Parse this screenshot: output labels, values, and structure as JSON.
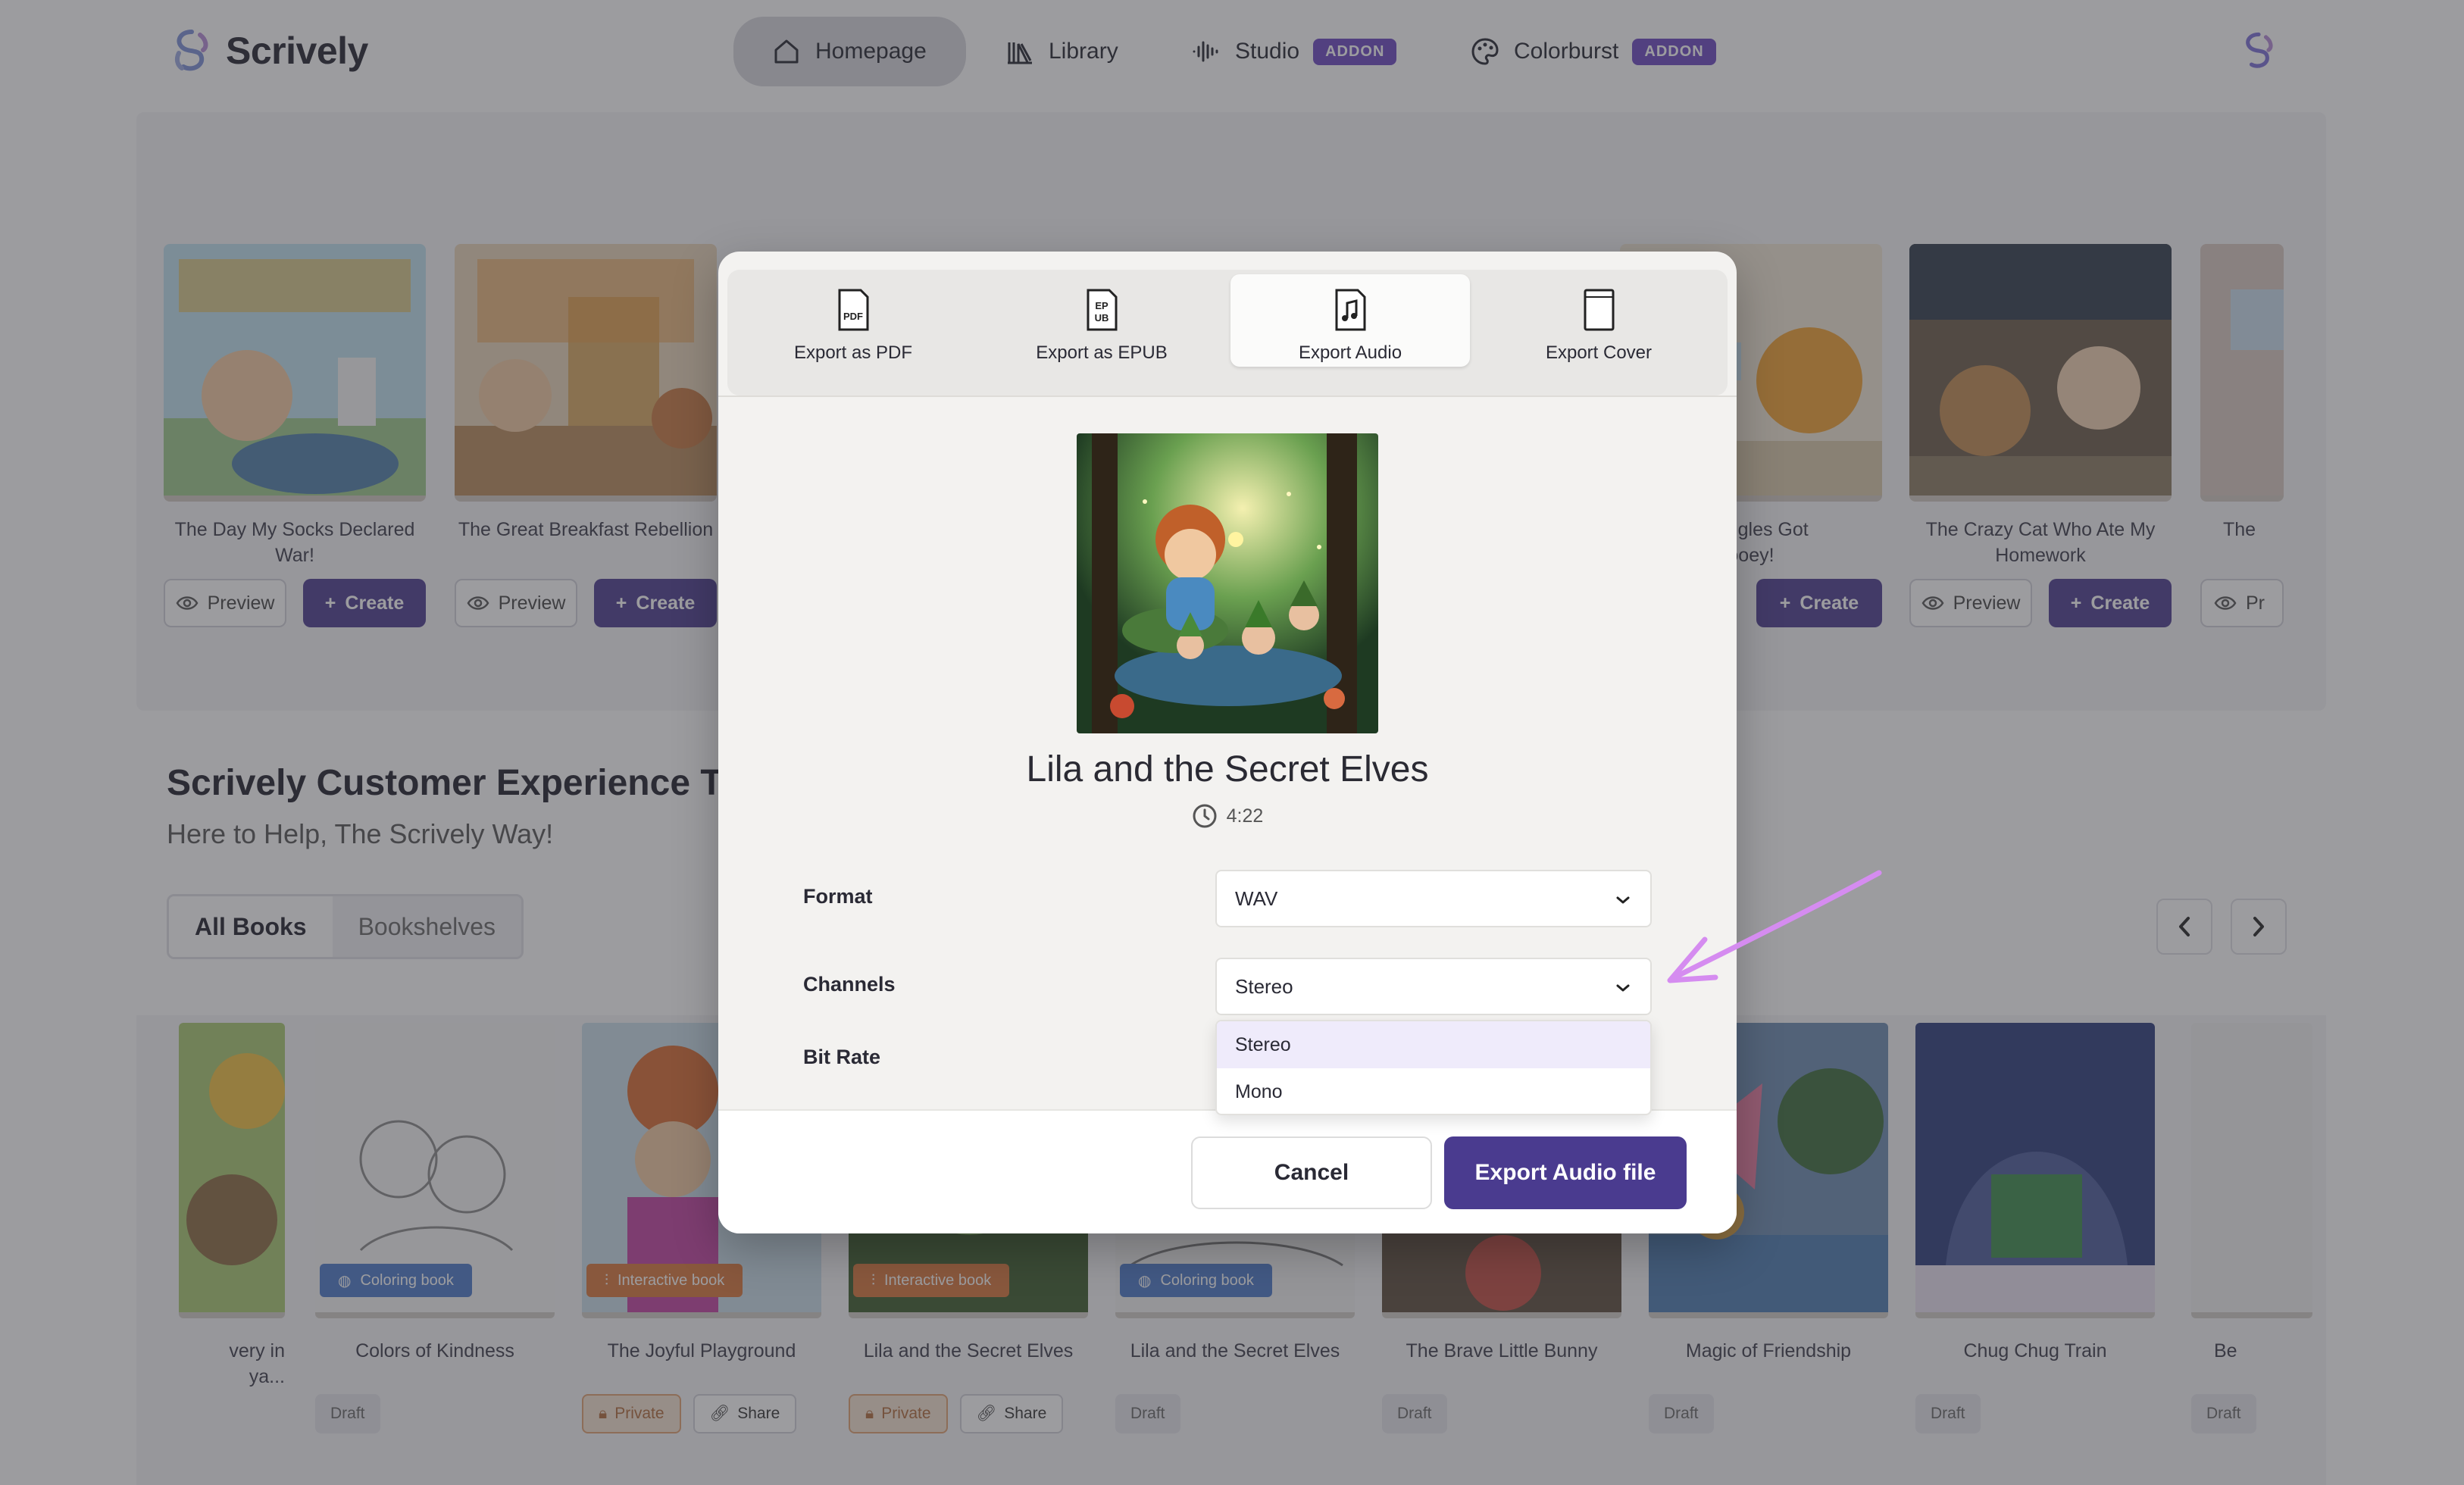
{
  "nav": {
    "brand": "Scrively",
    "items": [
      {
        "label": "Homepage",
        "icon": "home-icon",
        "active": true
      },
      {
        "label": "Library",
        "icon": "library-icon"
      },
      {
        "label": "Studio",
        "icon": "waveform-icon",
        "badge": "ADDON"
      },
      {
        "label": "Colorburst",
        "icon": "palette-icon",
        "badge": "ADDON"
      }
    ]
  },
  "featured": {
    "books": [
      {
        "title": "The Day My Socks Declared War!"
      },
      {
        "title": "The Great Breakfast Rebellion"
      },
      {
        "title": "y Giggles Got\nooey!"
      },
      {
        "title": "The Crazy Cat Who Ate My Homework"
      },
      {
        "title": "The"
      }
    ],
    "preview_label": "Preview",
    "create_label": "Create",
    "preview_partial": "Pr"
  },
  "section": {
    "title": "Scrively Customer Experience Te",
    "subtitle": "Here to Help, The Scrively Way!",
    "tabs": [
      "All Books",
      "Bookshelves"
    ]
  },
  "shelf": {
    "books": [
      {
        "title": "very in\nya...",
        "status": "Draft"
      },
      {
        "title": "Colors of Kindness",
        "tag": "Coloring book",
        "status": "Draft"
      },
      {
        "title": "The Joyful Playground",
        "tag": "Interactive book",
        "status": "Private",
        "share": "Share"
      },
      {
        "title": "Lila and the Secret Elves",
        "tag": "Interactive book",
        "status": "Private",
        "share": "Share"
      },
      {
        "title": "Lila and the Secret Elves",
        "tag": "Coloring book",
        "status": "Draft"
      },
      {
        "title": "The Brave Little Bunny",
        "status": "Draft"
      },
      {
        "title": "Magic of Friendship",
        "status": "Draft"
      },
      {
        "title": "Chug Chug Train",
        "status": "Draft"
      },
      {
        "title": "Be",
        "status": "Draft"
      }
    ]
  },
  "modal": {
    "tabs": [
      {
        "label": "Export as PDF",
        "icon": "pdf-file-icon"
      },
      {
        "label": "Export as EPUB",
        "icon": "epub-file-icon"
      },
      {
        "label": "Export Audio",
        "icon": "audio-file-icon",
        "active": true
      },
      {
        "label": "Export Cover",
        "icon": "cover-file-icon"
      }
    ],
    "book_title": "Lila and the Secret Elves",
    "duration": "4:22",
    "fields": {
      "format": {
        "label": "Format",
        "value": "WAV"
      },
      "channels": {
        "label": "Channels",
        "value": "Stereo",
        "options": [
          "Stereo",
          "Mono"
        ]
      },
      "bitrate": {
        "label": "Bit Rate"
      }
    },
    "cancel_label": "Cancel",
    "export_label": "Export Audio file"
  },
  "colors": {
    "accent": "#4a3b8f",
    "badge": "#6b46c1",
    "annotation": "#d58cf0"
  }
}
